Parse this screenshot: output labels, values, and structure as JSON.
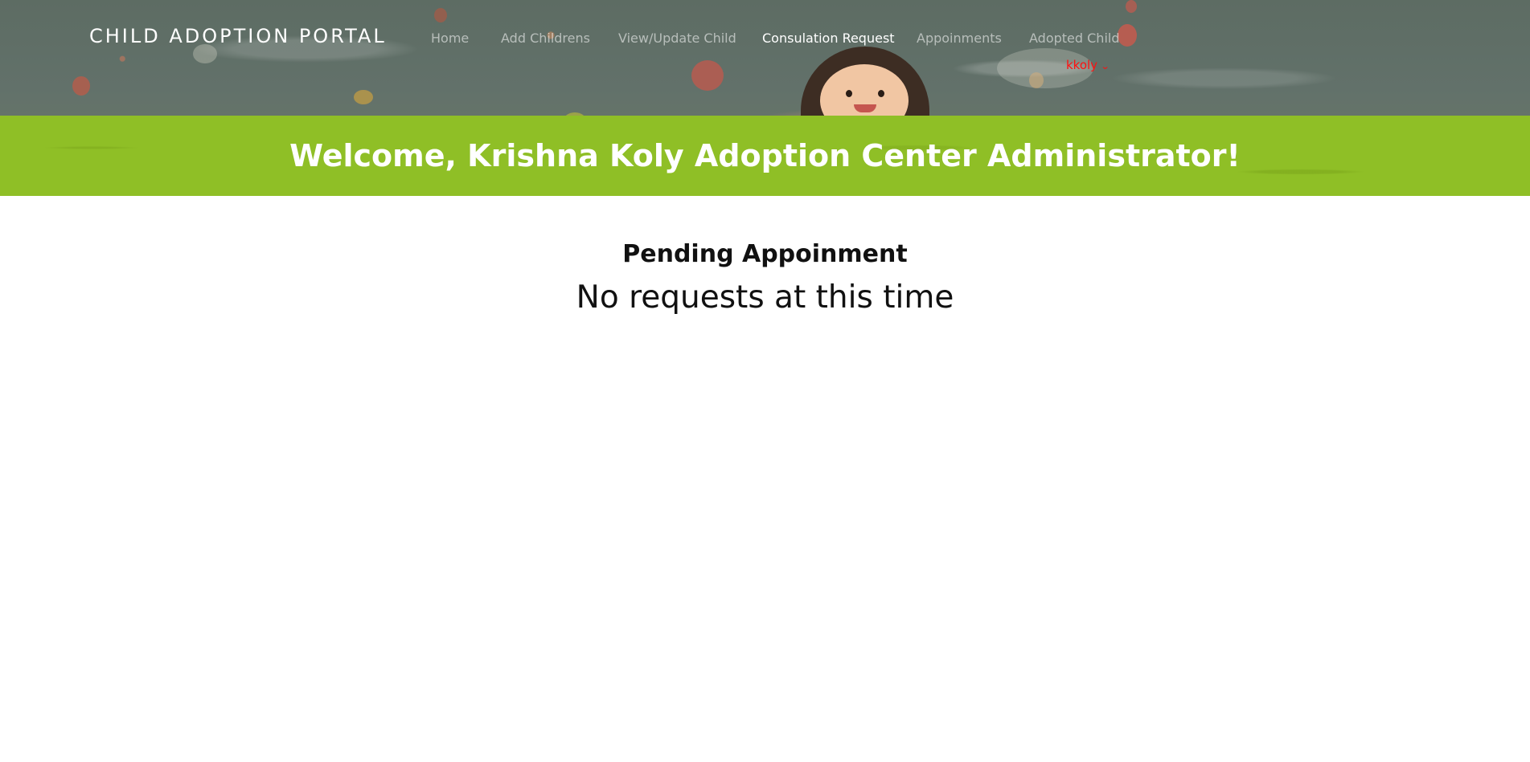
{
  "header": {
    "brand": "CHILD ADOPTION PORTAL",
    "nav": [
      {
        "label": "Home"
      },
      {
        "label": "Add Childrens"
      },
      {
        "label": "View/Update Child"
      },
      {
        "label": "Consulation Request"
      },
      {
        "label": "Appoinments"
      },
      {
        "label": "Adopted Child"
      }
    ],
    "active_nav": "Consulation Request",
    "user": {
      "name": "kkoly",
      "icon": "chevron-down-icon"
    }
  },
  "banner": {
    "title": "Welcome, Krishna Koly Adoption Center Administrator!"
  },
  "main": {
    "heading": "Pending Appoinment",
    "empty_message": "No requests at this time"
  },
  "colors": {
    "banner_green": "#8fbf26",
    "user_red": "#ff1010",
    "nav_active": "#ffffff",
    "nav_inactive": "rgba(255,255,255,0.55)"
  }
}
